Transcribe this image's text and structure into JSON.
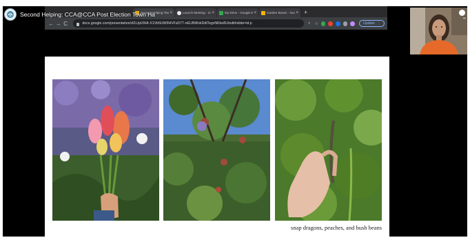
{
  "video": {
    "title": "Second Helping: CCA@CCA Post Election Town Ha"
  },
  "browser": {
    "tabs": [
      {
        "label": "Second Helping Town H",
        "active": true
      },
      {
        "label": "Launch Meeting - Zoom",
        "active": false
      },
      {
        "label": "My Drive - Google Drive",
        "active": false
      },
      {
        "label": "Garden Boxes - Google",
        "active": false
      }
    ],
    "tab_close": "×",
    "new_tab": "+",
    "back": "←",
    "forward": "→",
    "reload": "C",
    "url": "docs.google.com/presentation/d/1UpU9Ht-X1Vb5UW9HVFsD77-nEUNWvkDdiTegvNKbo8U/edit#slide=id.p",
    "update_label": "Update",
    "update_menu": "⋮",
    "zoom_icon": "⌕",
    "star_icon": "☆"
  },
  "slide": {
    "caption": "snap dragons, peaches, and bush beans"
  },
  "webcam": {
    "speaker_label": "W"
  },
  "colors": {
    "screen_bg": "#000000",
    "browser_bg": "#2b2b2e",
    "toolbar_bg": "#3c4043",
    "accent": "#8ab4f8"
  }
}
